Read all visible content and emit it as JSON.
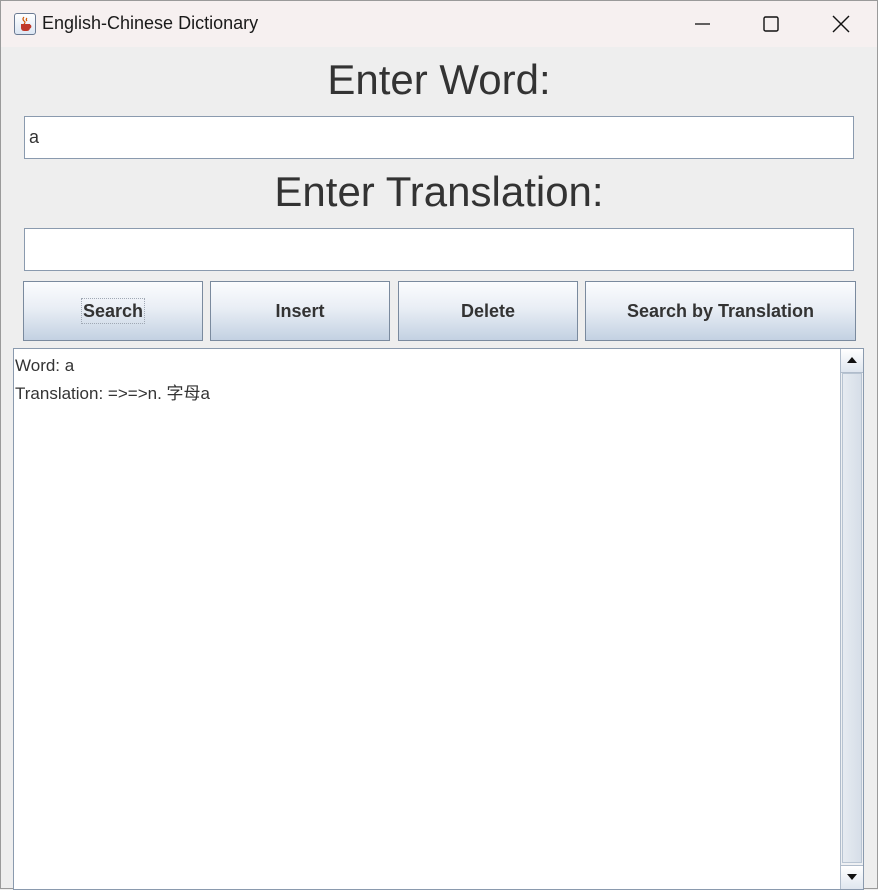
{
  "window": {
    "title": "English-Chinese Dictionary",
    "icon": "java-cup-icon"
  },
  "form": {
    "word_label": "Enter Word:",
    "word_value": "a",
    "translation_label": "Enter Translation:",
    "translation_value": ""
  },
  "buttons": {
    "search": "Search",
    "insert": "Insert",
    "delete": "Delete",
    "search_by_translation": "Search by Translation"
  },
  "result": {
    "word_line": "Word: a",
    "translation_line": "Translation: =>=>n. 字母a"
  },
  "colors": {
    "window_bg": "#eeeeee",
    "button_gradient_top": "#fbfcfe",
    "button_gradient_bottom": "#c3d1e2",
    "text": "#333333"
  }
}
